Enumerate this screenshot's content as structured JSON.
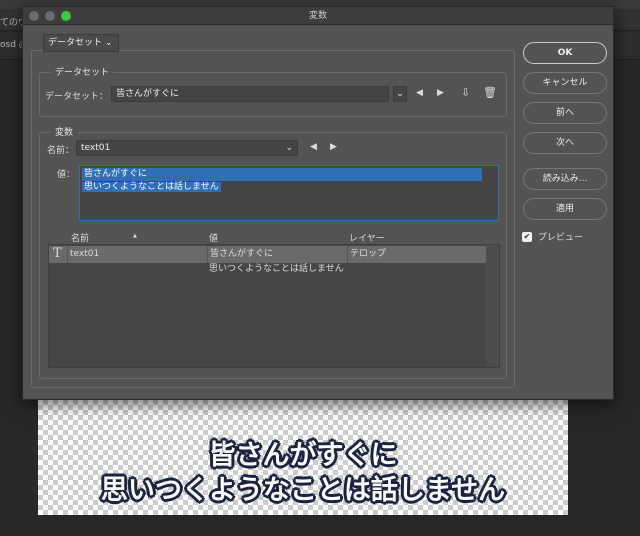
{
  "background": {
    "tab_fragment": "てのウ",
    "doc_fragment": "osd @"
  },
  "canvas": {
    "caption_line1": "皆さんがすぐに",
    "caption_line2": "思いつくようなことは話しません"
  },
  "dialog": {
    "title": "変数",
    "mode_dropdown": "データセット",
    "dataset_group": {
      "legend": "データセット",
      "label": "データセット：",
      "value": "皆さんがすぐに"
    },
    "variable_group": {
      "legend": "変数",
      "name_label": "名前：",
      "name_value": "text01",
      "value_label": "値：",
      "value_lines": [
        "皆さんがすぐに",
        "思いつくようなことは話しません"
      ]
    },
    "table": {
      "columns": [
        "名前",
        "値",
        "レイヤー"
      ],
      "sort_indicator": "▲",
      "rows": [
        {
          "type_icon": "T",
          "name": "text01",
          "value_line1": "皆さんがすぐに",
          "value_line2": "思いつくようなことは話しません",
          "layer": "テロップ"
        }
      ]
    },
    "buttons": {
      "ok": "OK",
      "cancel": "キャンセル",
      "prev": "前へ",
      "next": "次へ",
      "import": "読み込み...",
      "apply": "適用"
    },
    "preview": {
      "label": "プレビュー",
      "checked": true
    },
    "colors": {
      "accent": "#2e6fb7",
      "dialog_bg": "#535353",
      "close_light": "#6a6a6a",
      "zoom_light": "#3fc83f"
    }
  }
}
